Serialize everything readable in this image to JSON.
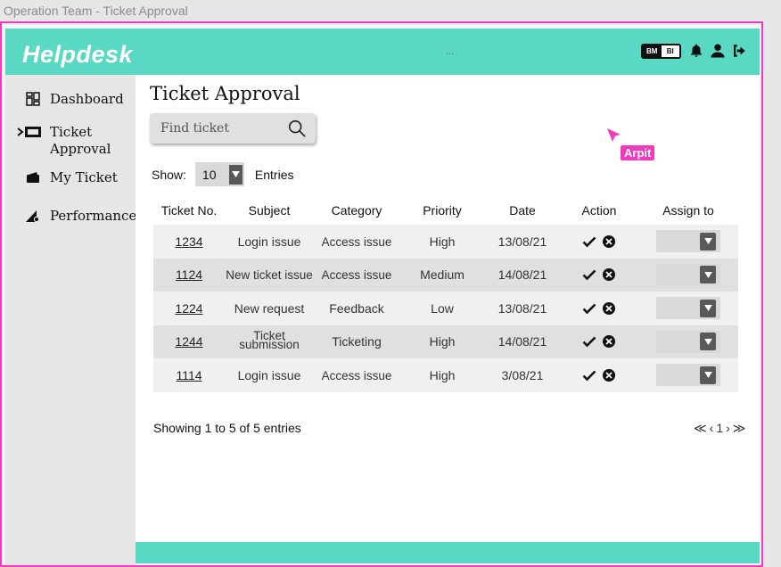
{
  "window_title": "Operation Team - Ticket Approval",
  "header": {
    "brand": "Helpdesk",
    "dots": "...",
    "lang_on": "BM",
    "lang_off": "BI",
    "icons": [
      "bell-icon",
      "user-icon",
      "logout-icon"
    ],
    "color": "#59d8c4"
  },
  "sidebar": {
    "items": [
      {
        "label": "Dashboard",
        "icon": "dashboard-icon"
      },
      {
        "label": "Ticket Approval",
        "icon": "ticket-icon",
        "active": true
      },
      {
        "label": "My Ticket",
        "icon": "my-ticket-icon"
      },
      {
        "label": "Performance",
        "icon": "performance-icon"
      }
    ]
  },
  "main": {
    "title": "Ticket Approval",
    "search_placeholder": "Find ticket",
    "show_label": "Show:",
    "show_value": "10",
    "entries_label": "Entries",
    "columns": [
      "Ticket No.",
      "Subject",
      "Category",
      "Priority",
      "Date",
      "Action",
      "Assign to"
    ],
    "rows": [
      {
        "no": "1234",
        "subject": "Login issue",
        "category": "Access issue",
        "priority": "High",
        "date": "13/08/21"
      },
      {
        "no": "1124",
        "subject": "New ticket issue",
        "category": "Access issue",
        "priority": "Medium",
        "date": "14/08/21"
      },
      {
        "no": "1224",
        "subject": "New request",
        "category": "Feedback",
        "priority": "Low",
        "date": "13/08/21"
      },
      {
        "no": "1244",
        "subject": "Ticket submission",
        "category": "Ticketing",
        "priority": "High",
        "date": "14/08/21"
      },
      {
        "no": "1114",
        "subject": "Login issue",
        "category": "Access issue",
        "priority": "High",
        "date": "3/08/21"
      }
    ],
    "showing_text": "Showing 1 to 5 of 5 entries",
    "pager": {
      "first": "≪",
      "prev": "‹",
      "page": "1",
      "next": "›",
      "last": "≫"
    }
  },
  "cursor_label": "Arpit",
  "accent": "#f03bbf"
}
